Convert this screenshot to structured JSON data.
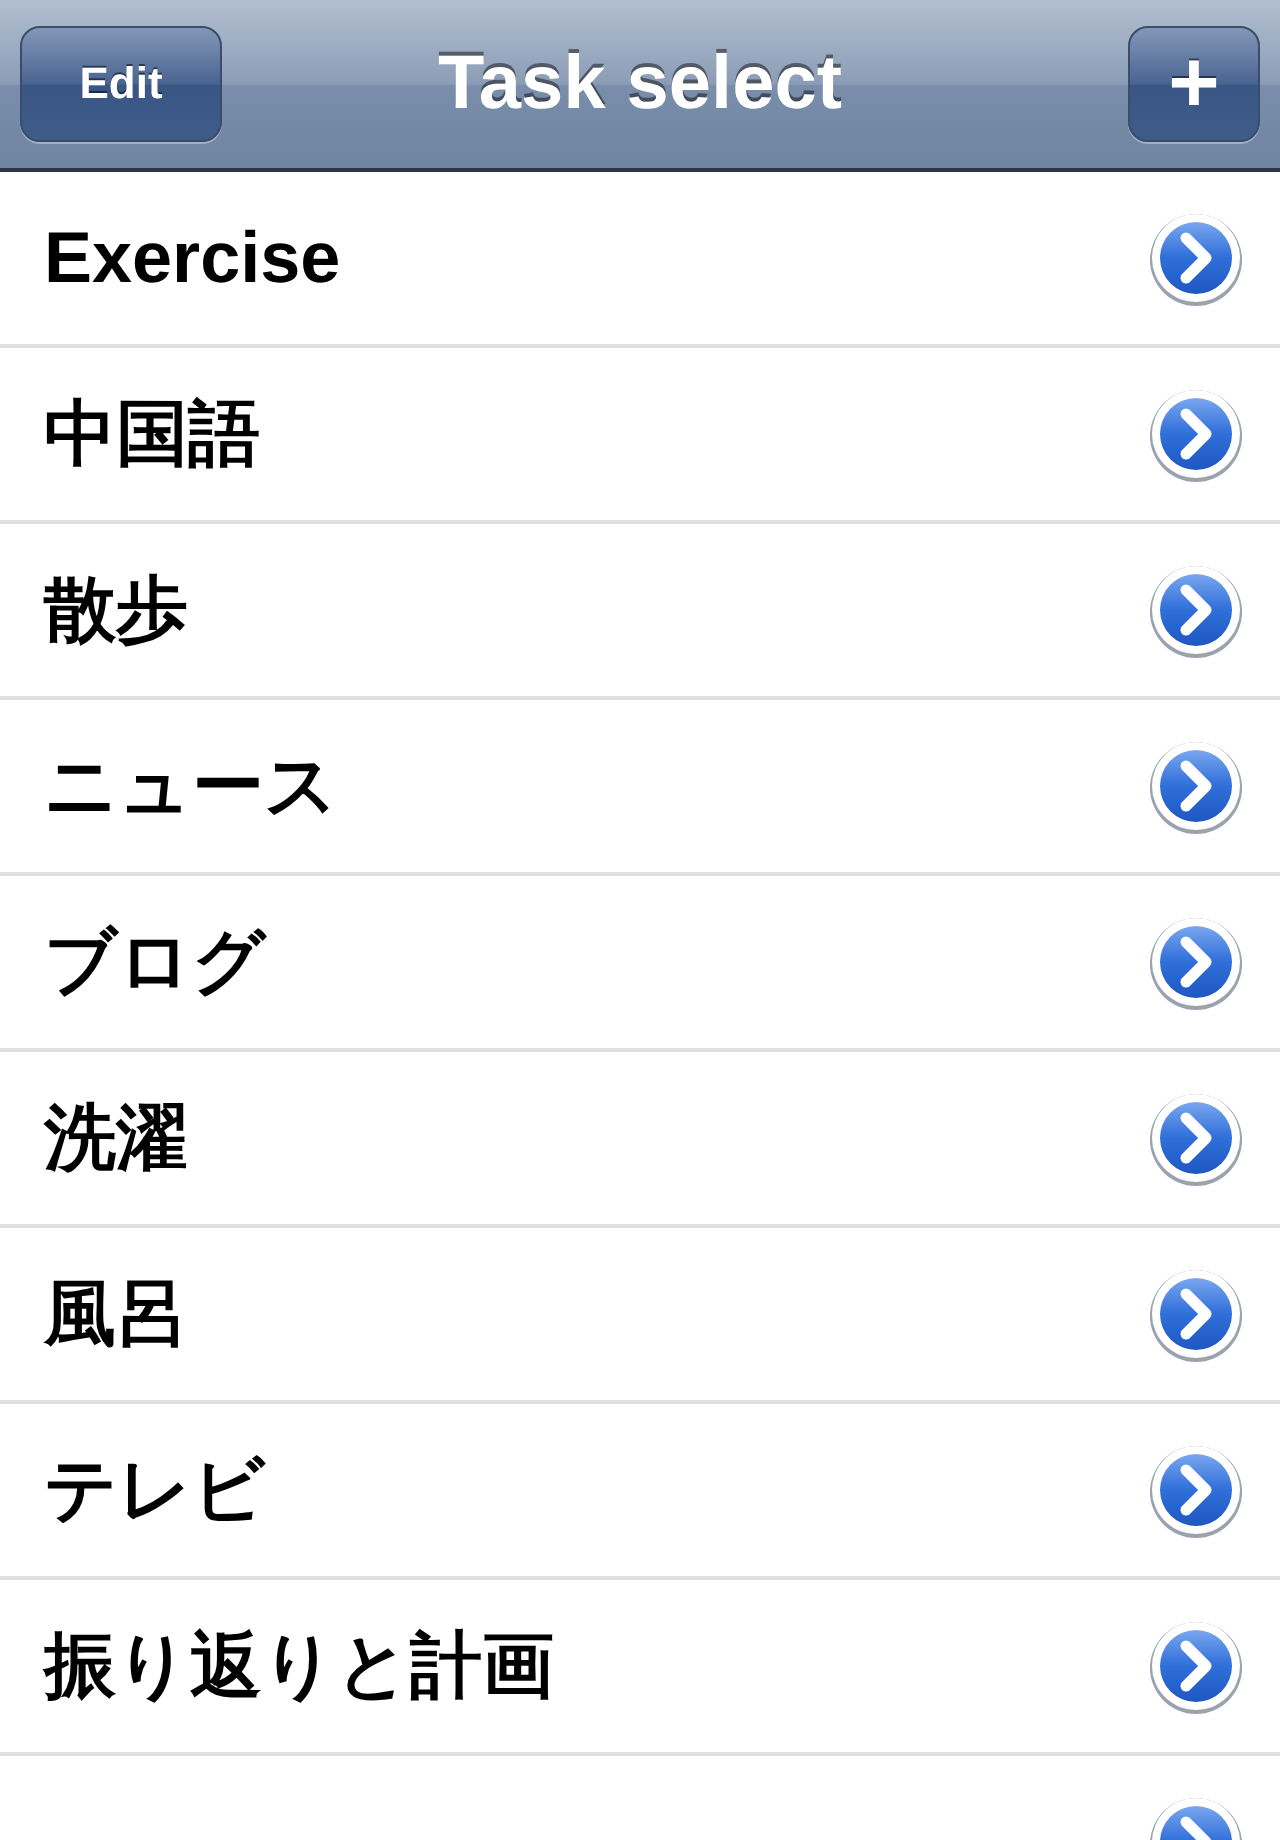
{
  "nav_bar": {
    "edit_button": "Edit",
    "title": "Task select",
    "add_button": "+"
  },
  "rows": [
    {
      "label": "Exercise"
    },
    {
      "label": "中国語"
    },
    {
      "label": "散歩"
    },
    {
      "label": "ニュース"
    },
    {
      "label": "ブログ"
    },
    {
      "label": "洗濯"
    },
    {
      "label": "風呂"
    },
    {
      "label": "テレビ"
    },
    {
      "label": "振り返りと計画"
    },
    {}
  ]
}
